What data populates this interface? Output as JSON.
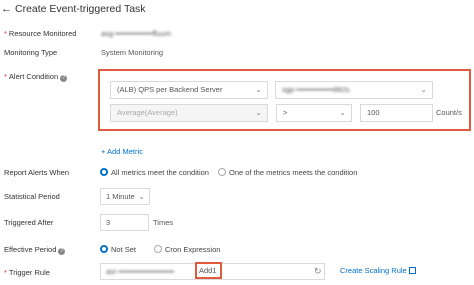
{
  "header": {
    "back_icon": "arrow-left-icon",
    "title": "Create Event-triggered Task"
  },
  "fields": {
    "resource_monitored": {
      "label": "Resource Monitored",
      "value": "asg-••••••••••••••ffuum"
    },
    "monitoring_type": {
      "label": "Monitoring Type",
      "value": "System Monitoring"
    },
    "alert_condition": {
      "label": "Alert Condition",
      "metric": "(ALB) QPS per Backend Server",
      "server_group": "sgp-••••••••••••••882s",
      "statistic": "Average(Average)",
      "operator": ">",
      "threshold": "100",
      "unit": "Count/s"
    },
    "add_metric": "+ Add Metric",
    "report_alerts_when": {
      "label": "Report Alerts When",
      "options": [
        "All metrics meet the condition",
        "One of the metrics meets the condition"
      ],
      "selected": "All metrics meet the condition"
    },
    "statistical_period": {
      "label": "Statistical Period",
      "value": "1 Minute"
    },
    "triggered_after": {
      "label": "Triggered After",
      "value": "3",
      "unit": "Times"
    },
    "effective_period": {
      "label": "Effective Period",
      "options": [
        "Not Set",
        "Cron Expression"
      ],
      "selected": "Not Set"
    },
    "trigger_rule": {
      "label": "Trigger Rule",
      "value_prefix": "asr-•••••••••••••••••••••",
      "value_suffix": "Add1",
      "create_link": "Create Scaling Rule"
    }
  },
  "colors": {
    "accent": "#0070cc",
    "highlight": "#e05a3e",
    "required": "#ee2233"
  }
}
